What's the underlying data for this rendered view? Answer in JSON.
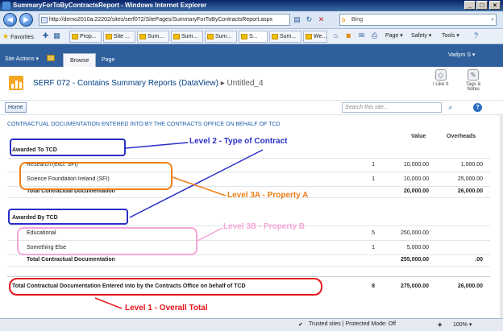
{
  "window": {
    "title": "SummaryForToByContractsReport - Windows Internet Explorer"
  },
  "browser": {
    "url": "http://demo2010a:22202/sites/serf072/SitePages/SummaryForToByContractsReport.aspx",
    "search_engine": "Bing",
    "favorites_label": "Favorites",
    "tabs": [
      "Prop...",
      "Site ...",
      "Sum...",
      "Sum...",
      "Sum...",
      "S...",
      "Sum...",
      "We..."
    ],
    "menus": {
      "page": "Page",
      "safety": "Safety",
      "tools": "Tools"
    }
  },
  "ribbon": {
    "site_actions": "Site Actions",
    "tabs": [
      "Browse",
      "Page"
    ],
    "user": "Vadym S"
  },
  "site": {
    "title": "SERF 072 - Contains Summary Reports (DataView)",
    "crumb": "Untitled_4",
    "like_label": "I Like It",
    "tags_label_1": "Tags &",
    "tags_label_2": "Notes",
    "home_label": "Home",
    "search_placeholder": "Search this site..."
  },
  "report": {
    "heading": "CONTRACTUAL DOCUMENTATION ENTERED INTO BY THE CONTRACTS OFFICE ON BEHALF OF TCD",
    "columns": [
      "Value",
      "Overheads"
    ],
    "groups": [
      {
        "title": "Awarded To TCD",
        "rows": [
          {
            "name": "Research (excl. SFI)",
            "count": "1",
            "value": "10,000.00",
            "overheads": "1,000.00"
          },
          {
            "name": "Science Foundation Ireland (SFI)",
            "count": "1",
            "value": "10,000.00",
            "overheads": "25,000.00"
          }
        ],
        "total_label": "Total Contractual Documentation",
        "total_value": "20,000.00",
        "total_overheads": "26,000.00"
      },
      {
        "title": "Awarded By TCD",
        "rows": [
          {
            "name": "Educational",
            "count": "5",
            "value": "250,000.00",
            "overheads": ""
          },
          {
            "name": "Something Else",
            "count": "1",
            "value": "5,000.00",
            "overheads": ""
          }
        ],
        "total_label": "Total Contractual Documentation",
        "total_value": "255,000.00",
        "total_overheads": ".00"
      }
    ],
    "grand_total": {
      "label": "Total Contractual Documentation Entered into by the Contracts Office on behalf of TCD",
      "count": "8",
      "value": "275,000.00",
      "overheads": "26,000.00"
    }
  },
  "annotations": {
    "level2": "Level 2 - Type of Contract",
    "level3a": "Level 3A - Property A",
    "level3b": "Level 3B - Property B",
    "level1": "Level 1 - Overall Total",
    "colors": {
      "level1": "#e8141c",
      "level2": "#2b2fc8",
      "level3a": "#f07f18",
      "level3b": "#f5a6d8"
    }
  },
  "status": {
    "zone": "Trusted sites | Protected Mode: Off",
    "zoom": "100%"
  }
}
